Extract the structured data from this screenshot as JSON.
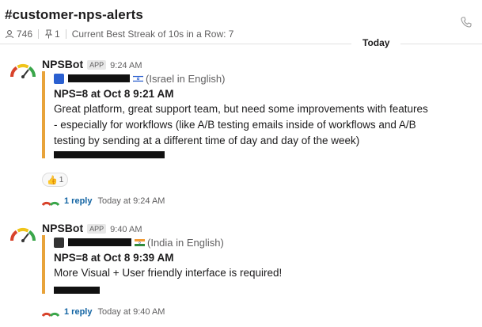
{
  "channel": {
    "title": "#customer-nps-alerts",
    "members": "746",
    "pins": "1",
    "topic": "Current Best Streak of 10s in a Row: 7"
  },
  "divider_label": "Today",
  "messages": [
    {
      "bot_name": "NPSBot",
      "badge": "APP",
      "time": "9:24 AM",
      "source_suffix": "(Israel in English)",
      "nps_title": "NPS=8 at Oct 8 9:21 AM",
      "body": "Great platform, great support team, but need some improvements with features - especially for workflows (like A/B testing emails inside of workflows and A/B testing by sending at a different time of day and day of the week)",
      "reaction": {
        "emoji": "👍",
        "count": "1"
      },
      "replies": "1 reply",
      "reply_time": "Today at 9:24 AM"
    },
    {
      "bot_name": "NPSBot",
      "badge": "APP",
      "time": "9:40 AM",
      "source_suffix": "(India in English)",
      "nps_title": "NPS=8 at Oct 8 9:39 AM",
      "body": "More Visual + User friendly interface is required!",
      "replies": "1 reply",
      "reply_time": "Today at 9:40 AM"
    }
  ],
  "colors": {
    "attachment_bar": "#e8a33a",
    "link": "#1264a3",
    "muted": "#616061"
  },
  "icons": [
    "member-icon",
    "pin-icon",
    "phone-icon",
    "gauge-avatar-icon",
    "israel-flag-icon",
    "india-flag-icon",
    "thumbs-up-icon"
  ]
}
